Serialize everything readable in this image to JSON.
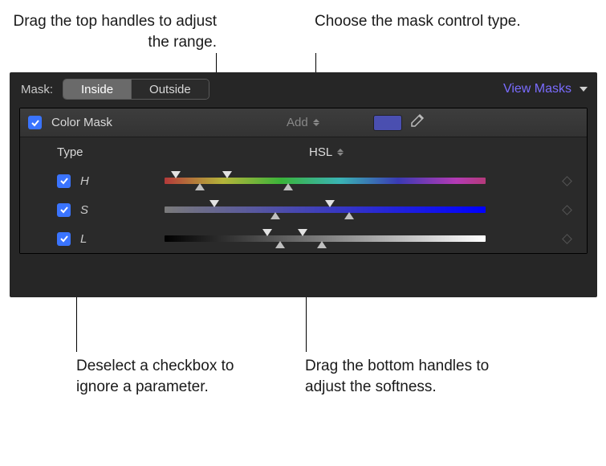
{
  "callouts": {
    "top_left": "Drag the top handles to adjust the range.",
    "top_right": "Choose the mask control type.",
    "bottom_left": "Deselect a checkbox to ignore a parameter.",
    "bottom_right": "Drag the bottom handles to adjust the softness."
  },
  "panel": {
    "mask_label": "Mask:",
    "seg_inside": "Inside",
    "seg_outside": "Outside",
    "seg_active": "Inside",
    "view_masks": "View Masks"
  },
  "mask": {
    "title": "Color Mask",
    "add_label": "Add",
    "type_label": "Type",
    "type_value": "HSL",
    "swatch_color": "#4a4fb0",
    "channels": [
      {
        "key": "H",
        "checked": true,
        "gradient": "hue",
        "top_handles": [
          14,
          78
        ],
        "bottom_handles": [
          44,
          154
        ]
      },
      {
        "key": "S",
        "checked": true,
        "gradient": "sat",
        "top_handles": [
          62,
          206
        ],
        "bottom_handles": [
          138,
          230
        ]
      },
      {
        "key": "L",
        "checked": true,
        "gradient": "lum",
        "top_handles": [
          128,
          172
        ],
        "bottom_handles": [
          144,
          196
        ]
      }
    ]
  }
}
